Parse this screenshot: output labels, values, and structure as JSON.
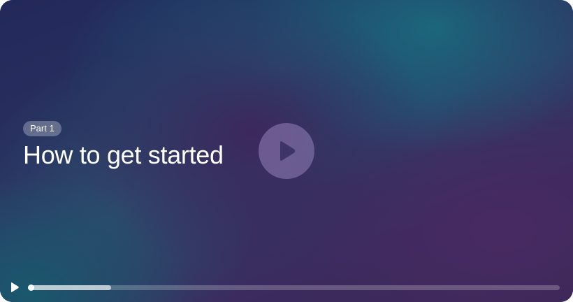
{
  "video": {
    "part_label": "Part 1",
    "title": "How to get started"
  },
  "controls": {
    "play_icon": "play-icon",
    "big_play_icon": "play-icon",
    "progress_fraction": 0.157
  },
  "colors": {
    "text": "#ffffff",
    "background_dark": "#23285a",
    "background_teal": "#1a6e80",
    "background_purple": "#3e265c"
  }
}
